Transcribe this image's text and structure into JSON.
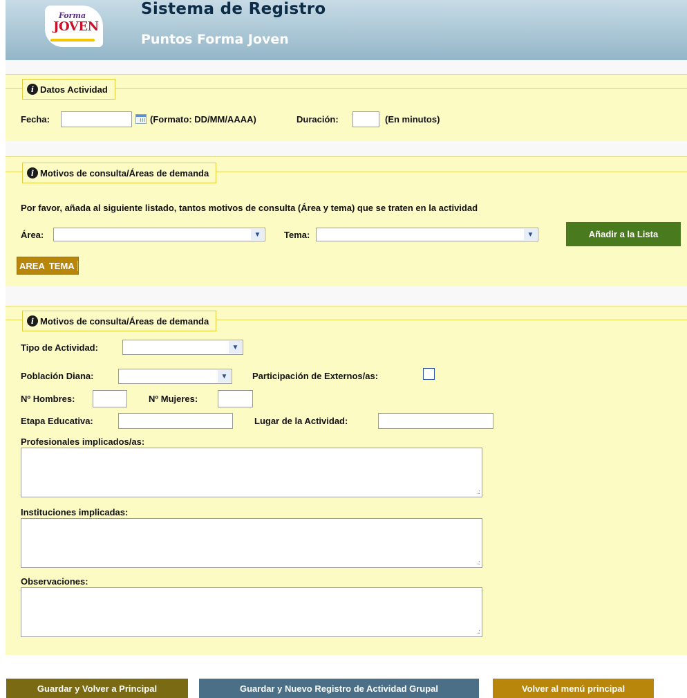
{
  "header": {
    "logo_line1": "Forma",
    "logo_line2": "JOVEN",
    "title": "Sistema de Registro",
    "subtitle": "Puntos Forma Joven"
  },
  "section1": {
    "legend": "Datos Actividad",
    "fecha_label": "Fecha:",
    "fecha_value": "",
    "fecha_hint": "(Formato: DD/MM/AAAA)",
    "duracion_label": "Duración:",
    "duracion_value": "",
    "duracion_hint": "(En minutos)"
  },
  "section2": {
    "legend": "Motivos de consulta/Áreas de demanda",
    "instructions": "Por favor, añada al siguiente listado, tantos motivos de consulta (Área y tema) que se traten en la actividad",
    "area_label": "Área:",
    "area_value": "",
    "tema_label": "Tema:",
    "tema_value": "",
    "add_button": "Añadir a la Lista",
    "table_headers": [
      "AREA",
      "TEMA"
    ]
  },
  "section3": {
    "legend": "Motivos de consulta/Áreas de demanda",
    "tipo_label": "Tipo de Actividad:",
    "tipo_value": "",
    "poblacion_label": "Población Diana:",
    "poblacion_value": "",
    "participacion_label": "Participación de Externos/as:",
    "hombres_label": "Nº Hombres:",
    "mujeres_label": "Nº Mujeres:",
    "etapa_label": "Etapa Educativa:",
    "lugar_label": "Lugar de la Actividad:",
    "profesionales_label": "Profesionales implicados/as:",
    "instituciones_label": "Instituciones implicadas:",
    "observaciones_label": "Observaciones:"
  },
  "footer": {
    "btn_save_back": "Guardar y Volver a Principal",
    "btn_save_new": "Guardar y Nuevo Registro de Actividad Grupal",
    "btn_back_menu": "Volver al menú principal"
  },
  "colors": {
    "header_gradient": [
      "#c7dbe6",
      "#93b6c8"
    ],
    "section_bg": "#fdfbc4",
    "legend_border": "#e3cc3c",
    "btn_green": "#4a7a1e",
    "btn_olive": "#7a6a14",
    "btn_slate": "#4a6f86",
    "btn_gold": "#b8860b"
  },
  "icons": [
    "info-icon",
    "calendar-icon",
    "chevron-down-icon",
    "resize-grip-icon"
  ]
}
